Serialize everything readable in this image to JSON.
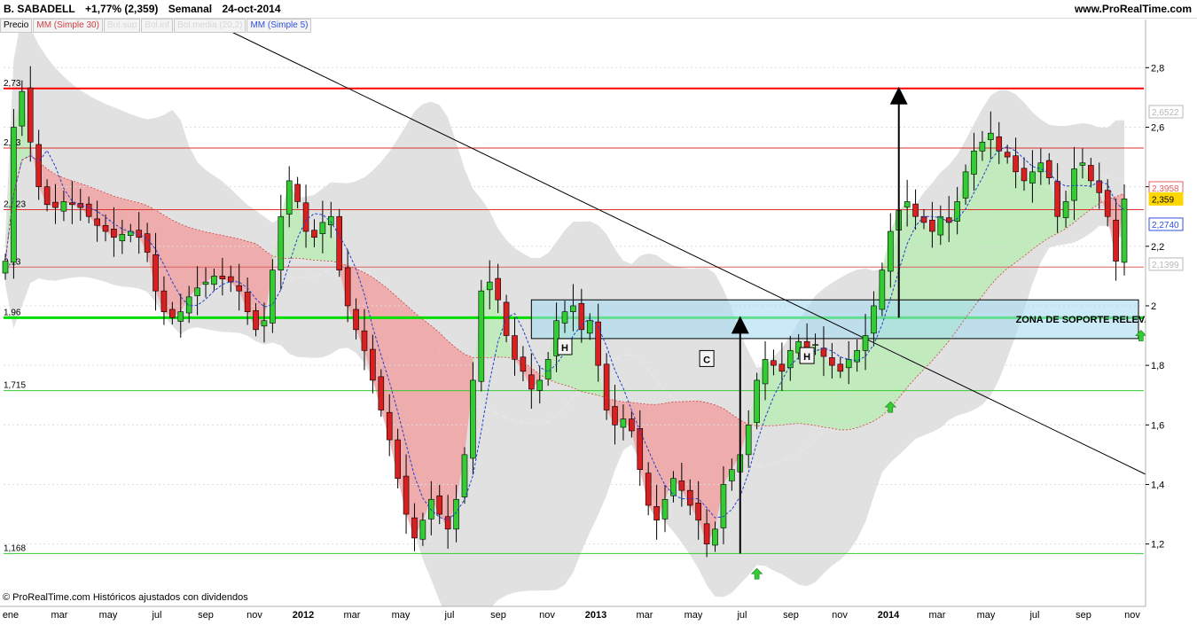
{
  "header": {
    "symbol": "B. SABADELL",
    "change": "+1,77% (2,359)",
    "period": "Semanal",
    "date": "24-oct-2014",
    "site": "www.ProRealTime.com"
  },
  "legend": {
    "items": [
      "Precio",
      "MM (Simple 30)",
      "Bol.sup",
      "Bol.inf",
      "Bol.media (20,2)",
      "MM (Simple 5)"
    ]
  },
  "footer": {
    "note": "© ProRealTime.com  Históricos ajustados con dividendos"
  },
  "chart_data": {
    "type": "candlestick",
    "title": "B. SABADELL",
    "x_tick_labels": [
      "ene",
      "mar",
      "may",
      "jul",
      "sep",
      "nov",
      "2012",
      "mar",
      "may",
      "jul",
      "sep",
      "nov",
      "2013",
      "mar",
      "may",
      "jul",
      "sep",
      "nov",
      "2014",
      "mar",
      "may",
      "jul",
      "sep",
      "nov"
    ],
    "y_tick_labels": [
      "2,8",
      "2,6",
      "2,4",
      "2,2",
      "2",
      "1,8",
      "1,6",
      "1,4",
      "1,2"
    ],
    "ylim": [
      1.05,
      2.92
    ],
    "horizontal_levels": [
      {
        "label": "2,73",
        "value": 2.73,
        "color": "#ff0000"
      },
      {
        "label": "2,53",
        "value": 2.53,
        "color": "#e03030"
      },
      {
        "label": "2,323",
        "value": 2.323,
        "color": "#e03030"
      },
      {
        "label": "2,13",
        "value": 2.13,
        "color": "#e06060"
      },
      {
        "label": "1,96",
        "value": 1.96,
        "color": "#00e000"
      },
      {
        "label": "1,715",
        "value": 1.715,
        "color": "#33cc33"
      },
      {
        "label": "1,168",
        "value": 1.168,
        "color": "#33cc33"
      }
    ],
    "right_axis_values": [
      {
        "label": "2,6522",
        "value": 2.652,
        "color": "#b8b8b8"
      },
      {
        "label": "2,3958",
        "value": 2.396,
        "color": "#e06060"
      },
      {
        "label": "2,359",
        "value": 2.359,
        "color": "#ffd700"
      },
      {
        "label": "2,2740",
        "value": 2.274,
        "color": "#3050e0"
      },
      {
        "label": "2,1399",
        "value": 2.14,
        "color": "#b8b8b8"
      }
    ],
    "support_zone": {
      "label": "ZONA DE SOPORTE RELEVANTE",
      "y_low": 1.89,
      "y_high": 2.02
    },
    "pattern_labels": [
      "H",
      "C",
      "H"
    ],
    "series": {
      "close": [
        2.15,
        2.6,
        2.72,
        2.55,
        2.4,
        2.34,
        2.33,
        2.35,
        2.34,
        2.33,
        2.3,
        2.27,
        2.25,
        2.23,
        2.24,
        2.25,
        2.23,
        2.18,
        2.05,
        1.98,
        1.96,
        1.98,
        2.03,
        2.06,
        2.08,
        2.1,
        2.09,
        2.08,
        2.05,
        1.98,
        1.92,
        1.95,
        2.12,
        2.3,
        2.42,
        2.35,
        2.25,
        2.23,
        2.28,
        2.3,
        2.12,
        2.0,
        1.92,
        1.85,
        1.75,
        1.65,
        1.55,
        1.42,
        1.3,
        1.22,
        1.28,
        1.35,
        1.3,
        1.25,
        1.35,
        1.5,
        1.75,
        2.05,
        2.08,
        2.02,
        1.9,
        1.82,
        1.78,
        1.72,
        1.75,
        1.82,
        1.95,
        1.98,
        2.0,
        1.92,
        1.95,
        1.8,
        1.65,
        1.6,
        1.62,
        1.58,
        1.45,
        1.33,
        1.28,
        1.35,
        1.42,
        1.38,
        1.33,
        1.28,
        1.2,
        1.25,
        1.4,
        1.45,
        1.5,
        1.6,
        1.75,
        1.82,
        1.8,
        1.78,
        1.85,
        1.88,
        1.86,
        1.87,
        1.83,
        1.8,
        1.78,
        1.82,
        1.85,
        1.9,
        2.0,
        2.12,
        2.25,
        2.32,
        2.35,
        2.3,
        2.28,
        2.25,
        2.3,
        2.28,
        2.35,
        2.45,
        2.52,
        2.55,
        2.58,
        2.52,
        2.5,
        2.45,
        2.42,
        2.45,
        2.48,
        2.43,
        2.3,
        2.35,
        2.46,
        2.48,
        2.42,
        2.38,
        2.3,
        2.15,
        2.359
      ]
    }
  }
}
